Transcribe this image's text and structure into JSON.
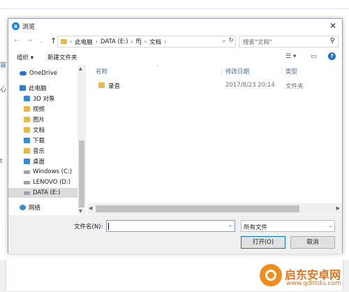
{
  "background": {
    "left_chars": [
      "容",
      "心",
      "t"
    ]
  },
  "dialog": {
    "title": "浏览",
    "breadcrumb": [
      "此电脑",
      "DATA (E:)",
      "ffj",
      "文档"
    ],
    "search_placeholder": "搜索\"文档\"",
    "toolbar": {
      "organize": "组织 ▾",
      "new_folder": "新建文件夹"
    },
    "nav_pane": [
      {
        "label": "OneDrive",
        "icon": "onedrive-icon"
      },
      {
        "label": "此电脑",
        "icon": "this-pc-icon"
      },
      {
        "label": "3D 对象",
        "icon": "folder-3d-icon"
      },
      {
        "label": "视频",
        "icon": "video-folder-icon"
      },
      {
        "label": "图片",
        "icon": "pictures-folder-icon"
      },
      {
        "label": "文档",
        "icon": "documents-folder-icon"
      },
      {
        "label": "下载",
        "icon": "downloads-folder-icon"
      },
      {
        "label": "音乐",
        "icon": "music-folder-icon"
      },
      {
        "label": "桌面",
        "icon": "desktop-folder-icon"
      },
      {
        "label": "Windows (C:)",
        "icon": "drive-c-icon"
      },
      {
        "label": "LENOVO (D:)",
        "icon": "drive-d-icon"
      },
      {
        "label": "DATA (E:)",
        "icon": "drive-e-icon",
        "selected": true
      },
      {
        "label": "网络",
        "icon": "network-icon"
      }
    ],
    "columns": {
      "name": "名称",
      "date": "修改日期",
      "type": "类型"
    },
    "files": [
      {
        "name": "录音",
        "date": "2017/8/23 20:14",
        "type": "文件夹"
      }
    ],
    "file_name_label": "文件名(N):",
    "file_name_value": "",
    "file_filter": "所有文件",
    "open_button": "打开(O)",
    "cancel_button": "取消"
  },
  "watermark": {
    "title": "启东安卓网",
    "url": "www.qdlttdu.com"
  },
  "colors": {
    "accent": "#0078d7",
    "folder": "#e8b84b",
    "watermark": "#e6731b"
  }
}
